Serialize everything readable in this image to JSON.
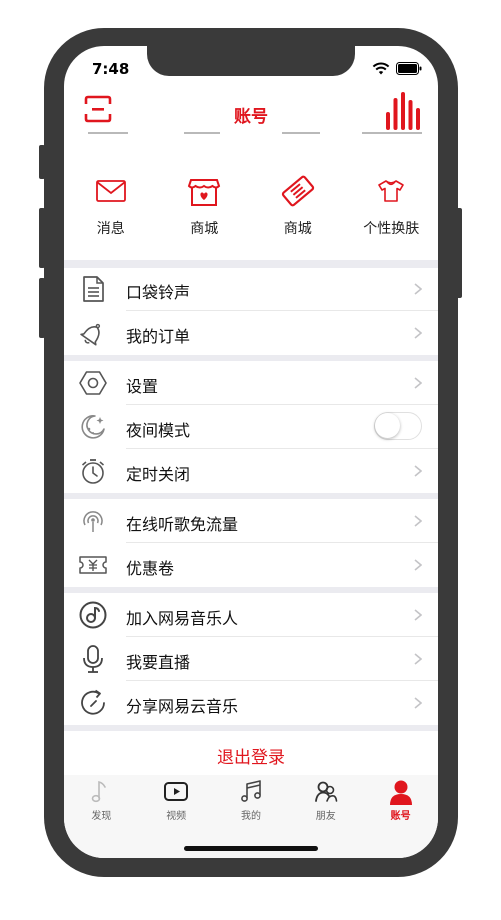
{
  "status": {
    "time": "7:48"
  },
  "nav": {
    "title": "账号"
  },
  "grid": [
    {
      "label": "消息",
      "icon": "mail-icon"
    },
    {
      "label": "商城",
      "icon": "store-icon"
    },
    {
      "label": "商城",
      "icon": "ticket-icon"
    },
    {
      "label": "个性换肤",
      "icon": "tshirt-icon"
    }
  ],
  "groups": {
    "g1": [
      {
        "label": "口袋铃声",
        "icon": "document-icon"
      },
      {
        "label": "我的订单",
        "icon": "bell-icon"
      }
    ],
    "g2": [
      {
        "label": "设置",
        "icon": "hexagon-icon"
      },
      {
        "label": "夜间模式",
        "icon": "moon-icon",
        "toggle": false
      },
      {
        "label": "定时关闭",
        "icon": "timer-icon"
      }
    ],
    "g3": [
      {
        "label": "在线听歌免流量",
        "icon": "signal-icon"
      },
      {
        "label": "优惠卷",
        "icon": "coupon-icon"
      }
    ],
    "g4": [
      {
        "label": "加入网易音乐人",
        "icon": "music-disc-icon"
      },
      {
        "label": "我要直播",
        "icon": "microphone-icon"
      },
      {
        "label": "分享网易云音乐",
        "icon": "share-icon"
      }
    ]
  },
  "logout": {
    "label": "退出登录"
  },
  "tabs": [
    {
      "label": "发现",
      "icon": "note-icon",
      "active": false
    },
    {
      "label": "视频",
      "icon": "play-icon",
      "active": false
    },
    {
      "label": "我的",
      "icon": "music-icon",
      "active": false
    },
    {
      "label": "朋友",
      "icon": "friends-icon",
      "active": false
    },
    {
      "label": "账号",
      "icon": "person-icon",
      "active": true
    }
  ],
  "colors": {
    "accent": "#e0161e",
    "separator": "#ebebf0",
    "frame": "#3a3a3a"
  }
}
